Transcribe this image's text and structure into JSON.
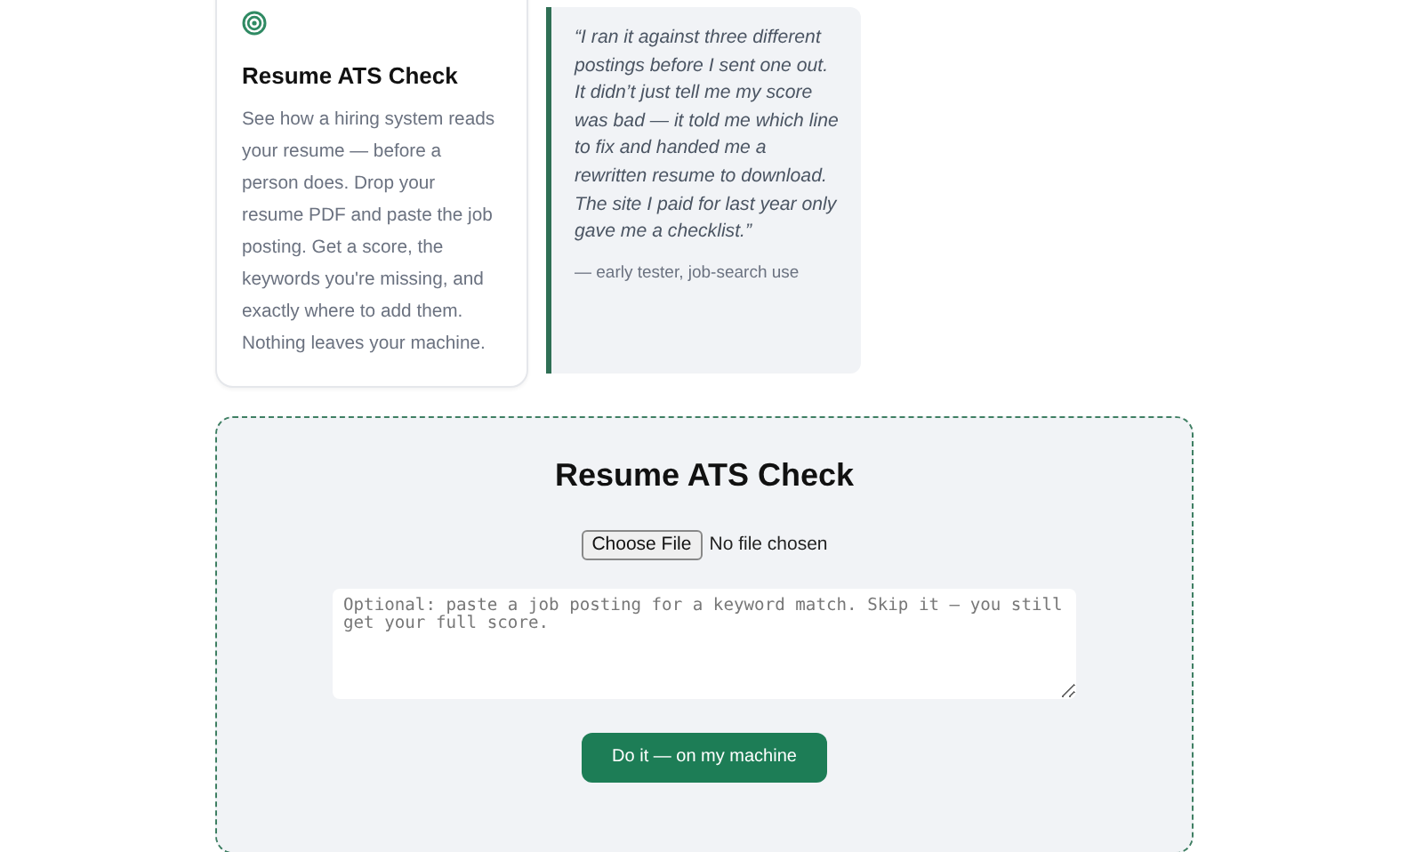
{
  "feature_card": {
    "title": "Resume ATS Check",
    "description": "See how a hiring system reads your resume — before a person does. Drop your resume PDF and paste the job posting. Get a score, the keywords you're missing, and exactly where to add them. Nothing leaves your machine."
  },
  "testimonial": {
    "quote": "“I ran it against three different postings before I sent one out. It didn’t just tell me my score was bad — it told me which line to fix and handed me a rewritten resume to download. The site I paid for last year only gave me a checklist.”",
    "attribution": "— early tester, job-search use"
  },
  "tool_panel": {
    "title": "Resume ATS Check",
    "file_button": "Choose File",
    "file_status": "No file chosen",
    "job_posting": {
      "placeholder": "Optional: paste a job posting for a keyword match. Skip it — you still get your full score."
    },
    "submit_button": "Do it — on my machine"
  }
}
